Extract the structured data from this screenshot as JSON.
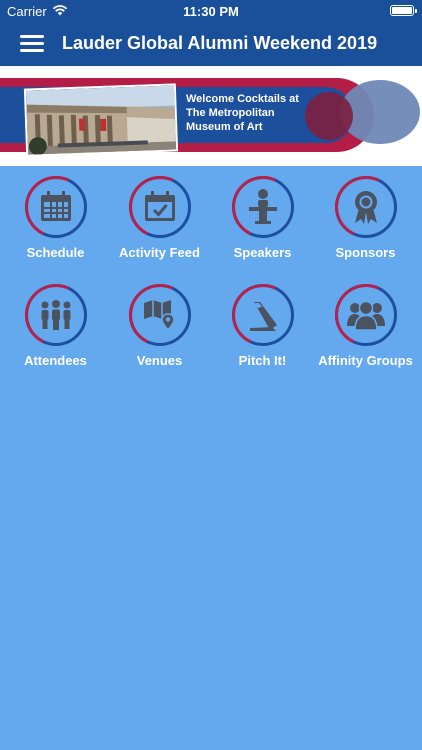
{
  "status": {
    "carrier": "Carrier",
    "time": "11:30 PM"
  },
  "nav": {
    "title": "Lauder Global Alumni Weekend 2019"
  },
  "banner": {
    "line1": "Welcome Cocktails at",
    "line2": "The Metropolitan",
    "line3": "Museum of Art"
  },
  "colors": {
    "nav": "#1a4f9a",
    "background": "#64a9ee",
    "ring_blue": "#1d4fa0",
    "ring_red": "#b5224d",
    "icon": "#4b5360"
  },
  "menu": [
    {
      "label": "Schedule",
      "icon": "calendar-icon"
    },
    {
      "label": "Activity Feed",
      "icon": "calendar-check-icon"
    },
    {
      "label": "Speakers",
      "icon": "speaker-podium-icon"
    },
    {
      "label": "Sponsors",
      "icon": "ribbon-award-icon"
    },
    {
      "label": "Attendees",
      "icon": "people-icon"
    },
    {
      "label": "Venues",
      "icon": "map-pin-icon"
    },
    {
      "label": "Pitch It!",
      "icon": "megaphone-icon"
    },
    {
      "label": "Affinity Groups",
      "icon": "group-icon"
    }
  ]
}
